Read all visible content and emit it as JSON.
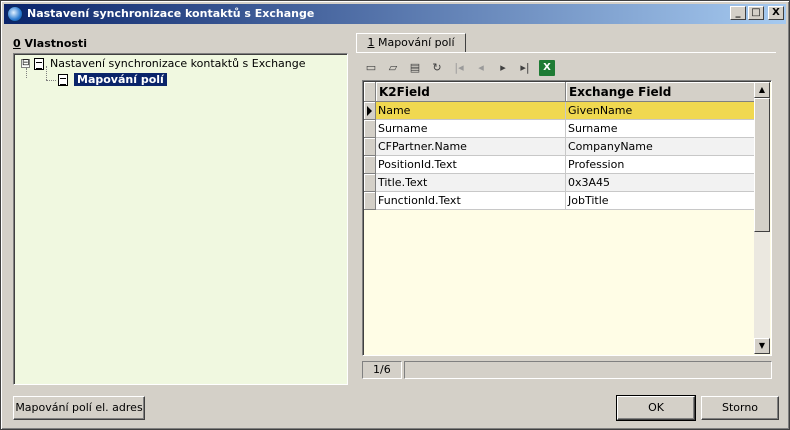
{
  "window": {
    "title": "Nastavení synchronizace kontaktů s Exchange",
    "controls": {
      "minimize": "_",
      "maximize": "□",
      "close": "X"
    }
  },
  "left_panel": {
    "label_prefix": "0",
    "label_text": " Vlastnosti",
    "tree": {
      "root": {
        "expander": "⊟",
        "label": "Nastavení synchronizace kontaktů s Exchange"
      },
      "child": {
        "label": "Mapování polí",
        "selected": true
      }
    }
  },
  "tab": {
    "label_prefix": "1",
    "label_text": " Mapování polí"
  },
  "toolbar": {
    "icons": [
      "new-icon",
      "open-icon",
      "delete-icon",
      "refresh-icon",
      "first-record-icon",
      "prev-record-icon",
      "next-record-icon",
      "last-record-icon",
      "excel-export-icon"
    ],
    "glyphs": {
      "first": "|◂",
      "prev": "◂",
      "next": "▸",
      "last": "▸|",
      "excel": "X"
    }
  },
  "grid": {
    "columns": [
      "K2Field",
      "Exchange Field"
    ],
    "rows": [
      [
        "Name",
        "GivenName"
      ],
      [
        "Surname",
        "Surname"
      ],
      [
        "CFPartner.Name",
        "CompanyName"
      ],
      [
        "PositionId.Text",
        "Profession"
      ],
      [
        "Title.Text",
        "0x3A45"
      ],
      [
        "FunctionId.Text",
        "JobTitle"
      ]
    ],
    "current_row": 0
  },
  "status": {
    "record_position": "1/6"
  },
  "buttons": {
    "email_mapping": "Mapování polí el. adres",
    "ok": "OK",
    "cancel": "Storno"
  },
  "colors": {
    "titlebar_start": "#0a246a",
    "titlebar_end": "#a6caf0",
    "tree_background": "#f0f8e0",
    "grid_background": "#fffde6",
    "current_row": "#f0d850",
    "window_face": "#d4d0c8"
  }
}
